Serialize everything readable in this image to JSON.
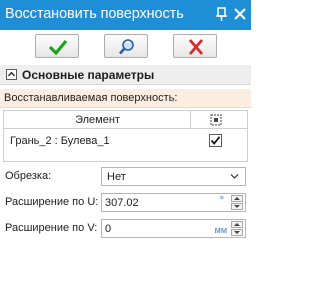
{
  "window": {
    "title": "Восстановить поверхность"
  },
  "icons": {
    "ok": "check-icon",
    "preview": "magnifier-icon",
    "cancel": "close-x-icon",
    "pin": "pin-icon",
    "close": "close-icon",
    "collapse": "collapse-icon",
    "column_select": "select-column-icon",
    "dropdown": "chevron-down-icon"
  },
  "colors": {
    "titlebar": "#1e8fd6",
    "ok": "#1ea31e",
    "cancel": "#d92a2a",
    "subheader_bg": "#fbeee0",
    "unit_text": "#3a7fc7"
  },
  "section": {
    "title": "Основные параметры"
  },
  "surface": {
    "label": "Восстанавливаемая поверхность:",
    "column_header": "Элемент",
    "rows": [
      {
        "element": "Грань_2 : Булева_1",
        "checked": true
      }
    ]
  },
  "params": {
    "trim_label": "Обрезка:",
    "trim_value": "Нет",
    "ext_u_label": "Расширение по U:",
    "ext_u_value": "307.02",
    "ext_u_unit": "°",
    "ext_v_label": "Расширение по V:",
    "ext_v_value": "0",
    "ext_v_unit": "мм"
  }
}
